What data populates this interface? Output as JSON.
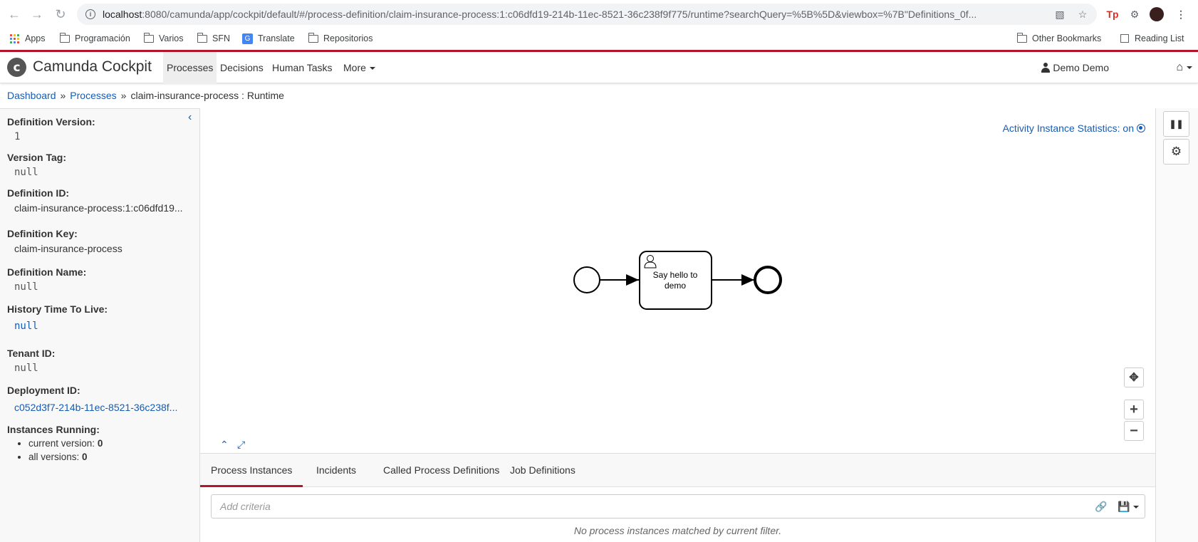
{
  "browser": {
    "url_host": "localhost",
    "url_path": ":8080/camunda/app/cockpit/default/#/process-definition/claim-insurance-process:1:c06dfd19-214b-11ec-8521-36c238f9f775/runtime?searchQuery=%5B%5D&viewbox=%7B\"Definitions_0f...",
    "bookmarks": [
      "Apps",
      "Programación",
      "Varios",
      "SFN",
      "Translate",
      "Repositorios"
    ],
    "bookmarks_right": [
      "Other Bookmarks",
      "Reading List"
    ]
  },
  "header": {
    "logo_letter": "c",
    "brand": "Camunda Cockpit",
    "nav": [
      "Processes",
      "Decisions",
      "Human Tasks",
      "More"
    ],
    "user": "Demo Demo"
  },
  "breadcrumb": {
    "dashboard": "Dashboard",
    "sep": "»",
    "processes": "Processes",
    "current": "claim-insurance-process : Runtime"
  },
  "sidebar": {
    "definition_version_label": "Definition Version:",
    "definition_version": "1",
    "version_tag_label": "Version Tag:",
    "version_tag": "null",
    "definition_id_label": "Definition ID:",
    "definition_id": "claim-insurance-process:1:c06dfd19...",
    "definition_key_label": "Definition Key:",
    "definition_key": "claim-insurance-process",
    "definition_name_label": "Definition Name:",
    "definition_name": "null",
    "history_ttl_label": "History Time To Live:",
    "history_ttl": "null",
    "tenant_id_label": "Tenant ID:",
    "tenant_id": "null",
    "deployment_id_label": "Deployment ID:",
    "deployment_id": "c052d3f7-214b-11ec-8521-36c238f...",
    "instances_running_label": "Instances Running:",
    "current_version_label": "current version:",
    "current_version_count": "0",
    "all_versions_label": "all versions:",
    "all_versions_count": "0"
  },
  "diagram": {
    "stats_label": "Activity Instance Statistics: on",
    "task_line1": "Say hello to",
    "task_line2": "demo"
  },
  "tabs": [
    "Process Instances",
    "Incidents",
    "Called Process Definitions",
    "Job Definitions"
  ],
  "search": {
    "placeholder": "Add criteria",
    "empty_message": "No process instances matched by current filter."
  },
  "colors": {
    "accent": "#b5152b",
    "link": "#155cb5"
  }
}
